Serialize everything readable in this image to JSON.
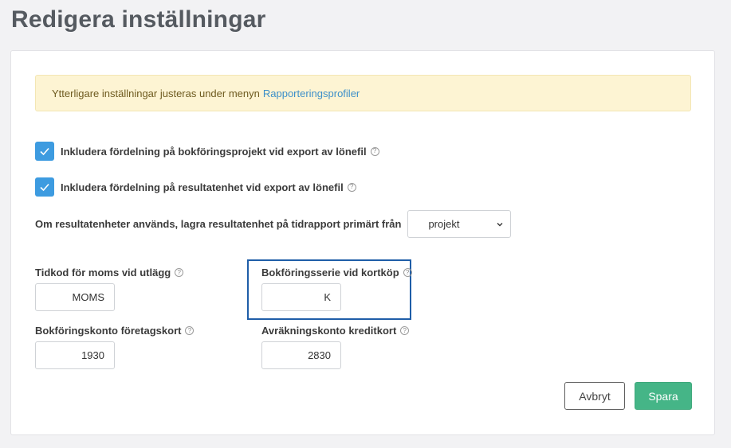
{
  "page": {
    "title": "Redigera inställningar"
  },
  "alert": {
    "text": "Ytterligare inställningar justeras under menyn",
    "link_text": "Rapporteringsprofiler"
  },
  "checkboxes": [
    {
      "label": "Inkludera fördelning på bokföringsprojekt vid export av lönefil",
      "checked": true
    },
    {
      "label": "Inkludera fördelning på resultatenhet vid export av lönefil",
      "checked": true
    }
  ],
  "result_unit": {
    "label": "Om resultatenheter används, lagra resultatenhet på tidrapport primärt från",
    "selected": "projekt"
  },
  "fields": {
    "vat_timecode": {
      "label": "Tidkod för moms vid utlägg",
      "value": "MOMS"
    },
    "card_series": {
      "label": "Bokföringsserie vid kortköp",
      "value": "K"
    },
    "company_card_account": {
      "label": "Bokföringskonto företagskort",
      "value": "1930"
    },
    "credit_card_account": {
      "label": "Avräkningskonto kreditkort",
      "value": "2830"
    }
  },
  "buttons": {
    "cancel": "Avbryt",
    "save": "Spara"
  },
  "colors": {
    "accent": "#3d9be0",
    "save": "#45b587",
    "alert_bg": "#fdf4d3",
    "link": "#3d8fc9",
    "highlight": "#1f5ea8"
  },
  "icons": {
    "help": "question-circle",
    "check": "checkmark",
    "chevron": "chevron-down"
  }
}
